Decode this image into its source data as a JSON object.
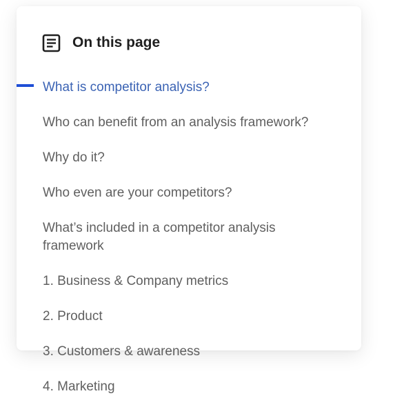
{
  "toc": {
    "header": {
      "icon": "document-lines-icon",
      "title": "On this page"
    },
    "active_index": 0,
    "colors": {
      "active_text": "#3b63b4",
      "active_indicator": "#1f4fd6",
      "inactive_text": "#5f5f5f",
      "title_text": "#1f1f1f"
    },
    "items": [
      {
        "label": "What is competitor analysis?"
      },
      {
        "label": "Who can benefit from an analysis framework?"
      },
      {
        "label": "Why do it?"
      },
      {
        "label": "Who even are your competitors?"
      },
      {
        "label": "What’s included in a competitor analysis framework"
      },
      {
        "label": "1. Business & Company metrics"
      },
      {
        "label": "2. Product"
      },
      {
        "label": "3. Customers & awareness"
      },
      {
        "label": "4. Marketing"
      }
    ]
  }
}
